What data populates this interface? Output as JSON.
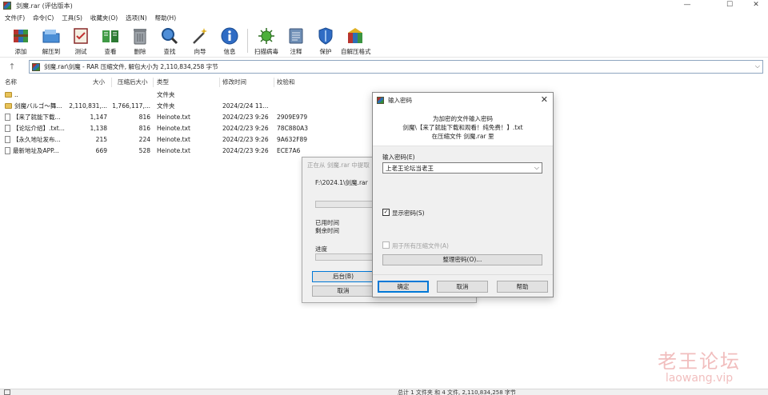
{
  "window": {
    "title": "剑魔.rar (评估版本)",
    "controls": [
      "—",
      "☐",
      "✕"
    ]
  },
  "menu": [
    "文件(F)",
    "命令(C)",
    "工具(S)",
    "收藏夹(O)",
    "选项(N)",
    "帮助(H)"
  ],
  "toolbar": [
    {
      "label": "添加",
      "icon": "add-archive-icon"
    },
    {
      "label": "解压到",
      "icon": "extract-to-icon"
    },
    {
      "label": "测试",
      "icon": "test-icon"
    },
    {
      "label": "查看",
      "icon": "view-icon"
    },
    {
      "label": "删除",
      "icon": "delete-icon"
    },
    {
      "label": "查找",
      "icon": "find-icon"
    },
    {
      "label": "向导",
      "icon": "wizard-icon"
    },
    {
      "label": "信息",
      "icon": "info-icon"
    },
    {
      "label": "扫描病毒",
      "icon": "virus-scan-icon"
    },
    {
      "label": "注释",
      "icon": "comment-icon"
    },
    {
      "label": "保护",
      "icon": "protect-icon"
    },
    {
      "label": "自解压格式",
      "icon": "sfx-icon"
    }
  ],
  "address": {
    "up": "🡑",
    "text": "剑魔.rar\\剑魔 - RAR 压缩文件, 解包大小为 2,110,834,258 字节"
  },
  "columns": [
    "名称",
    "大小",
    "压缩后大小",
    "类型",
    "修改时间",
    "校验和"
  ],
  "files": [
    {
      "name": "..",
      "size": "",
      "packed": "",
      "type": "文件夹",
      "modified": "",
      "crc": "",
      "kind": "folder"
    },
    {
      "name": "剑魔バルゴ～舞...",
      "size": "2,110,831,...",
      "packed": "1,766,117,...",
      "type": "文件夹",
      "modified": "2024/2/24 11...",
      "crc": "",
      "kind": "folder"
    },
    {
      "name": "【来了就能下载...",
      "size": "1,147",
      "packed": "816",
      "type": "Heinote.txt",
      "modified": "2024/2/23 9:26",
      "crc": "2909E979",
      "kind": "file"
    },
    {
      "name": "【论坛介绍】.txt...",
      "size": "1,138",
      "packed": "816",
      "type": "Heinote.txt",
      "modified": "2024/2/23 9:26",
      "crc": "78C880A3",
      "kind": "file"
    },
    {
      "name": "【永久地址发布...",
      "size": "215",
      "packed": "224",
      "type": "Heinote.txt",
      "modified": "2024/2/23 9:26",
      "crc": "9A632F89",
      "kind": "file"
    },
    {
      "name": "最新地址及APP...",
      "size": "669",
      "packed": "528",
      "type": "Heinote.txt",
      "modified": "2024/2/23 9:26",
      "crc": "ECE7A6",
      "kind": "file"
    }
  ],
  "progress_dialog": {
    "title": "正在从 剑魔.rar 中提取",
    "path": "F:\\2024.1\\剑魔.rar",
    "elapsed_label": "已用时间",
    "remaining_label": "剩余时间",
    "progress_label": "进度",
    "background_button": "后台(B)",
    "cancel_button": "取消"
  },
  "password_dialog": {
    "title": "输入密码",
    "info_line1": "为加密的文件输入密码",
    "info_line2": "剑魔\\【来了就能下载和观看！纯免费！】.txt",
    "info_line3": "在压缩文件 剑魔.rar 里",
    "enter_label": "输入密码(E)",
    "password_value": "上老王论坛当老王",
    "show_password_label": "显示密码(S)",
    "show_password_checked": "✓",
    "all_archives_label": "用于所有压缩文件(A)",
    "organize_button": "整理密码(O)...",
    "ok_button": "确定",
    "cancel_button": "取消",
    "help_button": "帮助"
  },
  "status": {
    "text": "总计 1 文件夹 和 4 文件, 2,110,834,258 字节"
  },
  "watermark": {
    "line1": "老王论坛",
    "line2": "laowang.vip"
  }
}
